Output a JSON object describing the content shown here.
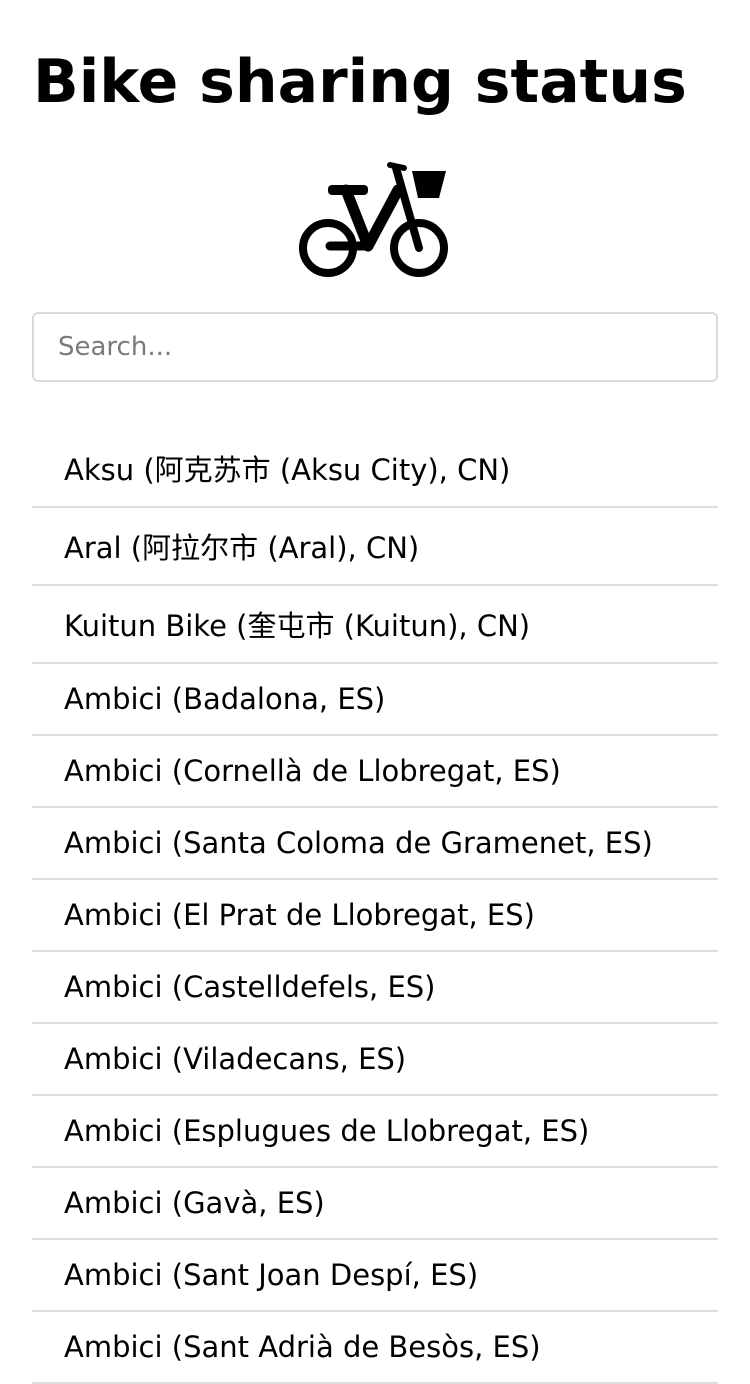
{
  "header": {
    "title": "Bike sharing status",
    "logo_icon": "bicycle-with-basket-icon"
  },
  "search": {
    "placeholder": "Search..."
  },
  "systems": [
    {
      "label": "Aksu (阿克苏市 (Aksu City), CN)"
    },
    {
      "label": "Aral (阿拉尔市 (Aral), CN)"
    },
    {
      "label": "Kuitun Bike (奎屯市 (Kuitun), CN)"
    },
    {
      "label": "Ambici (Badalona, ES)"
    },
    {
      "label": "Ambici (Cornellà de Llobregat, ES)"
    },
    {
      "label": "Ambici (Santa Coloma de Gramenet, ES)"
    },
    {
      "label": "Ambici (El Prat de Llobregat, ES)"
    },
    {
      "label": "Ambici (Castelldefels, ES)"
    },
    {
      "label": "Ambici (Viladecans, ES)"
    },
    {
      "label": "Ambici (Esplugues de Llobregat, ES)"
    },
    {
      "label": "Ambici (Gavà, ES)"
    },
    {
      "label": "Ambici (Sant Joan Despí, ES)"
    },
    {
      "label": "Ambici (Sant Adrià de Besòs, ES)"
    }
  ]
}
